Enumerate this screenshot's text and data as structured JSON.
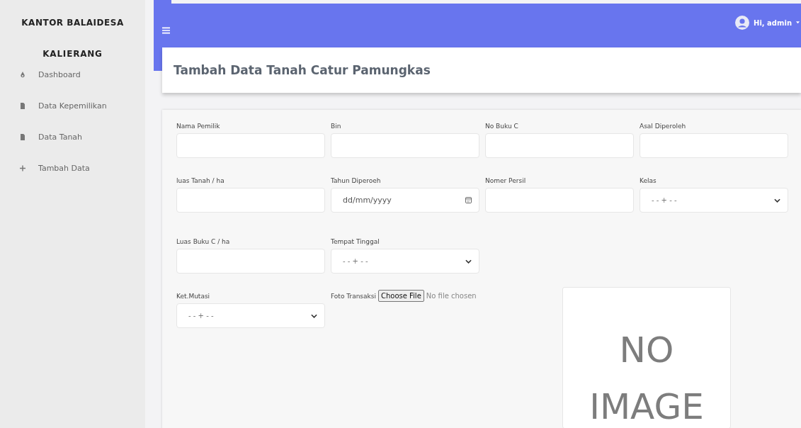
{
  "sidebar": {
    "brand": "KANTOR BALAIDESA",
    "subtitle": "KALIERANG",
    "items": [
      {
        "label": "Dashboard",
        "kind": "drop"
      },
      {
        "label": "Data Kepemilikan",
        "kind": "file"
      },
      {
        "label": "Data Tanah",
        "kind": "file"
      },
      {
        "label": "Tambah Data",
        "kind": "plus"
      }
    ]
  },
  "topbar": {
    "user": "Hi, admin"
  },
  "page_title": "Tambah Data Tanah Catur Pamungkas",
  "form": {
    "rows": [
      [
        {
          "label": "Nama Pemilik",
          "kind": "text"
        },
        {
          "label": "Bin",
          "kind": "text"
        },
        {
          "label": "No Buku C",
          "kind": "text"
        },
        {
          "label": "Asal Diperoleh",
          "kind": "text"
        }
      ],
      [
        {
          "label": "luas Tanah / ha",
          "kind": "text"
        },
        {
          "label": "Tahun Diperoeh",
          "kind": "date",
          "placeholder": "dd/mm/yyyy"
        },
        {
          "label": "Nomer Persil",
          "kind": "text"
        },
        {
          "label": "Kelas",
          "kind": "select",
          "value": "- - + - -"
        }
      ],
      [
        {
          "label": "Luas Buku C / ha",
          "kind": "text"
        },
        {
          "label": "Tempat Tinggal",
          "kind": "select",
          "value": "- - + - -"
        }
      ],
      [
        {
          "label": "Ket.Mutasi",
          "kind": "select",
          "value": "- - + - -"
        },
        {
          "label": "Foto Transaksi",
          "kind": "file",
          "button": "Choose File",
          "status": "No file chosen"
        }
      ]
    ],
    "preview": {
      "lines": [
        "NO",
        "IMAGE"
      ]
    }
  }
}
